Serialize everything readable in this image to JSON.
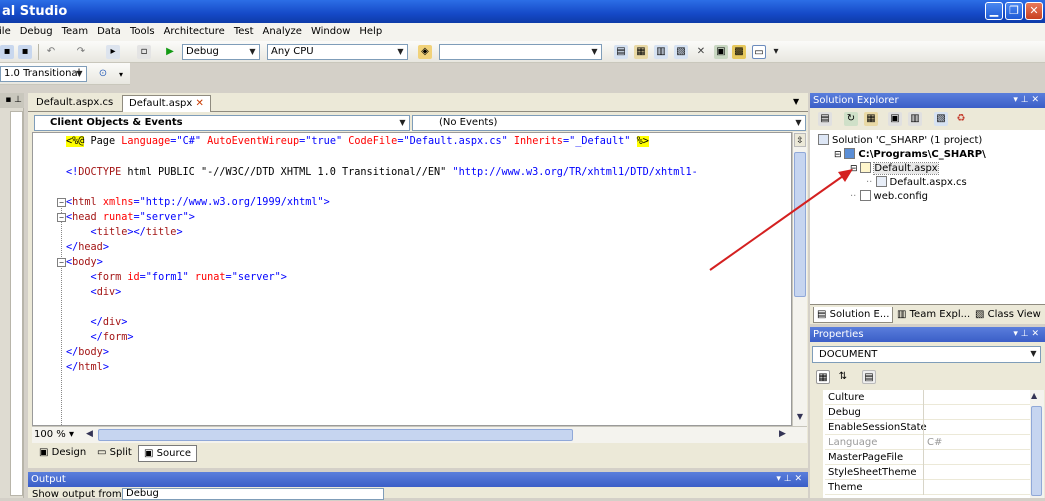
{
  "window": {
    "title": "al Studio",
    "controls": {
      "min": "▁",
      "max": "❐",
      "close": "✕"
    }
  },
  "menu": [
    "File",
    "Debug",
    "Team",
    "Data",
    "Tools",
    "Architecture",
    "Test",
    "Analyze",
    "Window",
    "Help"
  ],
  "toolbar": {
    "config": "Debug",
    "platform": "Any CPU",
    "find_value": "",
    "schema": "1.0 Transitional"
  },
  "doc_tabs": [
    {
      "label": "Default.aspx.cs",
      "active": false
    },
    {
      "label": "Default.aspx",
      "active": true
    }
  ],
  "object_bar": {
    "objects": "Client Objects & Events",
    "events": "(No Events)"
  },
  "code": [
    {
      "parts": [
        [
          "dir",
          "<%@"
        ],
        [
          "tx",
          " Page "
        ],
        [
          "at",
          "Language"
        ],
        [
          "bl",
          "="
        ],
        [
          "vl",
          "\"C#\""
        ],
        [
          "tx",
          " "
        ],
        [
          "at",
          "AutoEventWireup"
        ],
        [
          "bl",
          "="
        ],
        [
          "vl",
          "\"true\""
        ],
        [
          "tx",
          " "
        ],
        [
          "at",
          "CodeFile"
        ],
        [
          "bl",
          "="
        ],
        [
          "vl",
          "\"Default.aspx.cs\""
        ],
        [
          "tx",
          " "
        ],
        [
          "at",
          "Inherits"
        ],
        [
          "bl",
          "="
        ],
        [
          "vl",
          "\"_Default\""
        ],
        [
          "tx",
          " "
        ],
        [
          "dir",
          "%>"
        ]
      ]
    },
    {
      "parts": []
    },
    {
      "parts": [
        [
          "bl",
          "<!"
        ],
        [
          "tg",
          "DOCTYPE"
        ],
        [
          "tx",
          " html PUBLIC \"-//W3C//DTD XHTML 1.0 Transitional//EN\" "
        ],
        [
          "vl",
          "\"http://www.w3.org/TR/xhtml1/DTD/xhtml1-"
        ]
      ]
    },
    {
      "parts": []
    },
    {
      "parts": [
        [
          "bl",
          "<"
        ],
        [
          "tg",
          "html"
        ],
        [
          "tx",
          " "
        ],
        [
          "at",
          "xmlns"
        ],
        [
          "bl",
          "="
        ],
        [
          "vl",
          "\"http://www.w3.org/1999/xhtml\""
        ],
        [
          "bl",
          ">"
        ]
      ]
    },
    {
      "parts": [
        [
          "bl",
          "<"
        ],
        [
          "tg",
          "head"
        ],
        [
          "tx",
          " "
        ],
        [
          "at",
          "runat"
        ],
        [
          "bl",
          "="
        ],
        [
          "vl",
          "\"server\""
        ],
        [
          "bl",
          ">"
        ]
      ]
    },
    {
      "parts": [
        [
          "tx",
          "    "
        ],
        [
          "bl",
          "<"
        ],
        [
          "tg",
          "title"
        ],
        [
          "bl",
          "></"
        ],
        [
          "tg",
          "title"
        ],
        [
          "bl",
          ">"
        ]
      ]
    },
    {
      "parts": [
        [
          "bl",
          "</"
        ],
        [
          "tg",
          "head"
        ],
        [
          "bl",
          ">"
        ]
      ]
    },
    {
      "parts": [
        [
          "bl",
          "<"
        ],
        [
          "tg",
          "body"
        ],
        [
          "bl",
          ">"
        ]
      ]
    },
    {
      "parts": [
        [
          "tx",
          "    "
        ],
        [
          "bl",
          "<"
        ],
        [
          "tg",
          "form"
        ],
        [
          "tx",
          " "
        ],
        [
          "at",
          "id"
        ],
        [
          "bl",
          "="
        ],
        [
          "vl",
          "\"form1\""
        ],
        [
          "tx",
          " "
        ],
        [
          "at",
          "runat"
        ],
        [
          "bl",
          "="
        ],
        [
          "vl",
          "\"server\""
        ],
        [
          "bl",
          ">"
        ]
      ]
    },
    {
      "parts": [
        [
          "tx",
          "    "
        ],
        [
          "bl",
          "<"
        ],
        [
          "tg",
          "div"
        ],
        [
          "bl",
          ">"
        ]
      ]
    },
    {
      "parts": []
    },
    {
      "parts": [
        [
          "tx",
          "    "
        ],
        [
          "bl",
          "</"
        ],
        [
          "tg",
          "div"
        ],
        [
          "bl",
          ">"
        ]
      ]
    },
    {
      "parts": [
        [
          "tx",
          "    "
        ],
        [
          "bl",
          "</"
        ],
        [
          "tg",
          "form"
        ],
        [
          "bl",
          ">"
        ]
      ]
    },
    {
      "parts": [
        [
          "bl",
          "</"
        ],
        [
          "tg",
          "body"
        ],
        [
          "bl",
          ">"
        ]
      ]
    },
    {
      "parts": [
        [
          "bl",
          "</"
        ],
        [
          "tg",
          "html"
        ],
        [
          "bl",
          ">"
        ]
      ]
    }
  ],
  "zoom": "100 %",
  "views": [
    {
      "label": "Design",
      "icon": "design-icon"
    },
    {
      "label": "Split",
      "icon": "split-icon"
    },
    {
      "label": "Source",
      "icon": "source-icon",
      "active": true
    }
  ],
  "output": {
    "title": "Output",
    "show_from_label": "Show output from:",
    "source": "Debug"
  },
  "solution_explorer": {
    "title": "Solution Explorer",
    "nodes": [
      {
        "label": "Solution 'C_SHARP' (1 project)",
        "level": 0,
        "icon": "solution-icon"
      },
      {
        "label": "C:\\Programs\\C_SHARP\\",
        "level": 1,
        "icon": "website-icon",
        "bold": true
      },
      {
        "label": "Default.aspx",
        "level": 2,
        "icon": "aspx-file-icon",
        "selected": true
      },
      {
        "label": "Default.aspx.cs",
        "level": 3,
        "icon": "cs-file-icon"
      },
      {
        "label": "web.config",
        "level": 2,
        "icon": "config-file-icon"
      }
    ],
    "tabs": [
      "Solution E...",
      "Team Expl...",
      "Class View"
    ]
  },
  "properties": {
    "title": "Properties",
    "object": "DOCUMENT",
    "rows": [
      {
        "name": "Culture",
        "value": ""
      },
      {
        "name": "Debug",
        "value": ""
      },
      {
        "name": "EnableSessionState",
        "value": ""
      },
      {
        "name": "Language",
        "value": "C#",
        "disabled": true
      },
      {
        "name": "MasterPageFile",
        "value": ""
      },
      {
        "name": "StyleSheetTheme",
        "value": ""
      },
      {
        "name": "Theme",
        "value": ""
      }
    ]
  },
  "colors": {
    "arrow": "#d42020",
    "title_blue": "#1549c7",
    "directive_bg": "#ffff00"
  }
}
